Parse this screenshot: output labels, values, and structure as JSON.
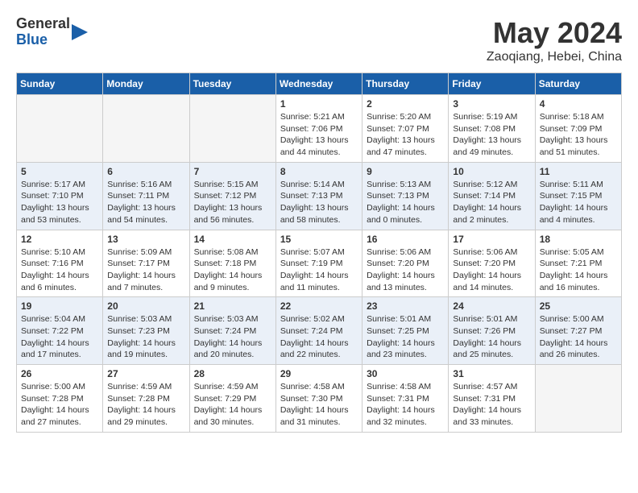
{
  "logo": {
    "general": "General",
    "blue": "Blue"
  },
  "title": {
    "month_year": "May 2024",
    "location": "Zaoqiang, Hebei, China"
  },
  "days_of_week": [
    "Sunday",
    "Monday",
    "Tuesday",
    "Wednesday",
    "Thursday",
    "Friday",
    "Saturday"
  ],
  "weeks": [
    [
      {
        "day": "",
        "info": ""
      },
      {
        "day": "",
        "info": ""
      },
      {
        "day": "",
        "info": ""
      },
      {
        "day": "1",
        "info": "Sunrise: 5:21 AM\nSunset: 7:06 PM\nDaylight: 13 hours\nand 44 minutes."
      },
      {
        "day": "2",
        "info": "Sunrise: 5:20 AM\nSunset: 7:07 PM\nDaylight: 13 hours\nand 47 minutes."
      },
      {
        "day": "3",
        "info": "Sunrise: 5:19 AM\nSunset: 7:08 PM\nDaylight: 13 hours\nand 49 minutes."
      },
      {
        "day": "4",
        "info": "Sunrise: 5:18 AM\nSunset: 7:09 PM\nDaylight: 13 hours\nand 51 minutes."
      }
    ],
    [
      {
        "day": "5",
        "info": "Sunrise: 5:17 AM\nSunset: 7:10 PM\nDaylight: 13 hours\nand 53 minutes."
      },
      {
        "day": "6",
        "info": "Sunrise: 5:16 AM\nSunset: 7:11 PM\nDaylight: 13 hours\nand 54 minutes."
      },
      {
        "day": "7",
        "info": "Sunrise: 5:15 AM\nSunset: 7:12 PM\nDaylight: 13 hours\nand 56 minutes."
      },
      {
        "day": "8",
        "info": "Sunrise: 5:14 AM\nSunset: 7:13 PM\nDaylight: 13 hours\nand 58 minutes."
      },
      {
        "day": "9",
        "info": "Sunrise: 5:13 AM\nSunset: 7:13 PM\nDaylight: 14 hours\nand 0 minutes."
      },
      {
        "day": "10",
        "info": "Sunrise: 5:12 AM\nSunset: 7:14 PM\nDaylight: 14 hours\nand 2 minutes."
      },
      {
        "day": "11",
        "info": "Sunrise: 5:11 AM\nSunset: 7:15 PM\nDaylight: 14 hours\nand 4 minutes."
      }
    ],
    [
      {
        "day": "12",
        "info": "Sunrise: 5:10 AM\nSunset: 7:16 PM\nDaylight: 14 hours\nand 6 minutes."
      },
      {
        "day": "13",
        "info": "Sunrise: 5:09 AM\nSunset: 7:17 PM\nDaylight: 14 hours\nand 7 minutes."
      },
      {
        "day": "14",
        "info": "Sunrise: 5:08 AM\nSunset: 7:18 PM\nDaylight: 14 hours\nand 9 minutes."
      },
      {
        "day": "15",
        "info": "Sunrise: 5:07 AM\nSunset: 7:19 PM\nDaylight: 14 hours\nand 11 minutes."
      },
      {
        "day": "16",
        "info": "Sunrise: 5:06 AM\nSunset: 7:20 PM\nDaylight: 14 hours\nand 13 minutes."
      },
      {
        "day": "17",
        "info": "Sunrise: 5:06 AM\nSunset: 7:20 PM\nDaylight: 14 hours\nand 14 minutes."
      },
      {
        "day": "18",
        "info": "Sunrise: 5:05 AM\nSunset: 7:21 PM\nDaylight: 14 hours\nand 16 minutes."
      }
    ],
    [
      {
        "day": "19",
        "info": "Sunrise: 5:04 AM\nSunset: 7:22 PM\nDaylight: 14 hours\nand 17 minutes."
      },
      {
        "day": "20",
        "info": "Sunrise: 5:03 AM\nSunset: 7:23 PM\nDaylight: 14 hours\nand 19 minutes."
      },
      {
        "day": "21",
        "info": "Sunrise: 5:03 AM\nSunset: 7:24 PM\nDaylight: 14 hours\nand 20 minutes."
      },
      {
        "day": "22",
        "info": "Sunrise: 5:02 AM\nSunset: 7:24 PM\nDaylight: 14 hours\nand 22 minutes."
      },
      {
        "day": "23",
        "info": "Sunrise: 5:01 AM\nSunset: 7:25 PM\nDaylight: 14 hours\nand 23 minutes."
      },
      {
        "day": "24",
        "info": "Sunrise: 5:01 AM\nSunset: 7:26 PM\nDaylight: 14 hours\nand 25 minutes."
      },
      {
        "day": "25",
        "info": "Sunrise: 5:00 AM\nSunset: 7:27 PM\nDaylight: 14 hours\nand 26 minutes."
      }
    ],
    [
      {
        "day": "26",
        "info": "Sunrise: 5:00 AM\nSunset: 7:28 PM\nDaylight: 14 hours\nand 27 minutes."
      },
      {
        "day": "27",
        "info": "Sunrise: 4:59 AM\nSunset: 7:28 PM\nDaylight: 14 hours\nand 29 minutes."
      },
      {
        "day": "28",
        "info": "Sunrise: 4:59 AM\nSunset: 7:29 PM\nDaylight: 14 hours\nand 30 minutes."
      },
      {
        "day": "29",
        "info": "Sunrise: 4:58 AM\nSunset: 7:30 PM\nDaylight: 14 hours\nand 31 minutes."
      },
      {
        "day": "30",
        "info": "Sunrise: 4:58 AM\nSunset: 7:31 PM\nDaylight: 14 hours\nand 32 minutes."
      },
      {
        "day": "31",
        "info": "Sunrise: 4:57 AM\nSunset: 7:31 PM\nDaylight: 14 hours\nand 33 minutes."
      },
      {
        "day": "",
        "info": ""
      }
    ]
  ]
}
